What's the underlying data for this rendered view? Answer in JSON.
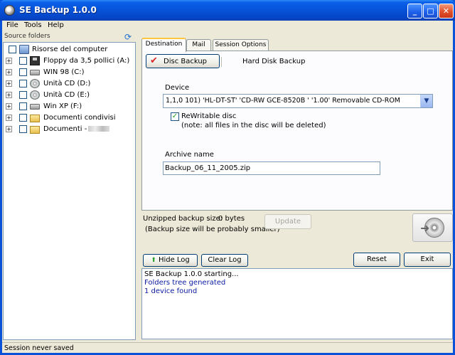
{
  "window": {
    "title": "SE Backup 1.0.0"
  },
  "menu": {
    "items": [
      "File",
      "Tools",
      "Help"
    ]
  },
  "tree": {
    "header": "Source folders",
    "nodes": [
      {
        "label": "Risorse del computer",
        "icon": "computer-icon"
      },
      {
        "label": "Floppy da 3,5 pollici (A:)",
        "icon": "floppy-icon"
      },
      {
        "label": "WIN 98 (C:)",
        "icon": "hard-drive-icon"
      },
      {
        "label": "Unità CD (D:)",
        "icon": "cd-drive-icon"
      },
      {
        "label": "Unità CD (E:)",
        "icon": "cd-drive-icon"
      },
      {
        "label": "Win XP (F:)",
        "icon": "hard-drive-icon"
      },
      {
        "label": "Documenti condivisi",
        "icon": "folder-icon"
      },
      {
        "label": "Documenti -",
        "icon": "folder-icon"
      }
    ]
  },
  "tabs": [
    "Destination",
    "Mail",
    "Session Options"
  ],
  "destination": {
    "disc_backup_label": "Disc Backup",
    "hard_disk_backup_label": "Hard Disk Backup",
    "device_label": "Device",
    "device_value": "1,1,0 101) 'HL-DT-ST' 'CD-RW GCE-8520B ' '1.00' Removable CD-ROM",
    "rewritable_label": "ReWritable disc",
    "rewritable_checked": true,
    "rewritable_note": "(note: all files in the disc will be deleted)",
    "archive_label": "Archive name",
    "archive_value": "Backup_06_11_2005.zip"
  },
  "size": {
    "label": "Unzipped backup size:",
    "value": "0 bytes",
    "note": "(Backup size will be probably smaller)",
    "update_label": "Update"
  },
  "buttons": {
    "hide_log": "Hide Log",
    "clear_log": "Clear Log",
    "reset": "Reset",
    "exit": "Exit"
  },
  "log": {
    "lines": [
      {
        "text": "SE Backup 1.0.0 starting...",
        "color": "#000000"
      },
      {
        "text": "Folders tree generated",
        "color": "#0a1aa0"
      },
      {
        "text": "1 device found",
        "color": "#0a1aa0"
      }
    ]
  },
  "status": {
    "text": "Session never saved"
  }
}
